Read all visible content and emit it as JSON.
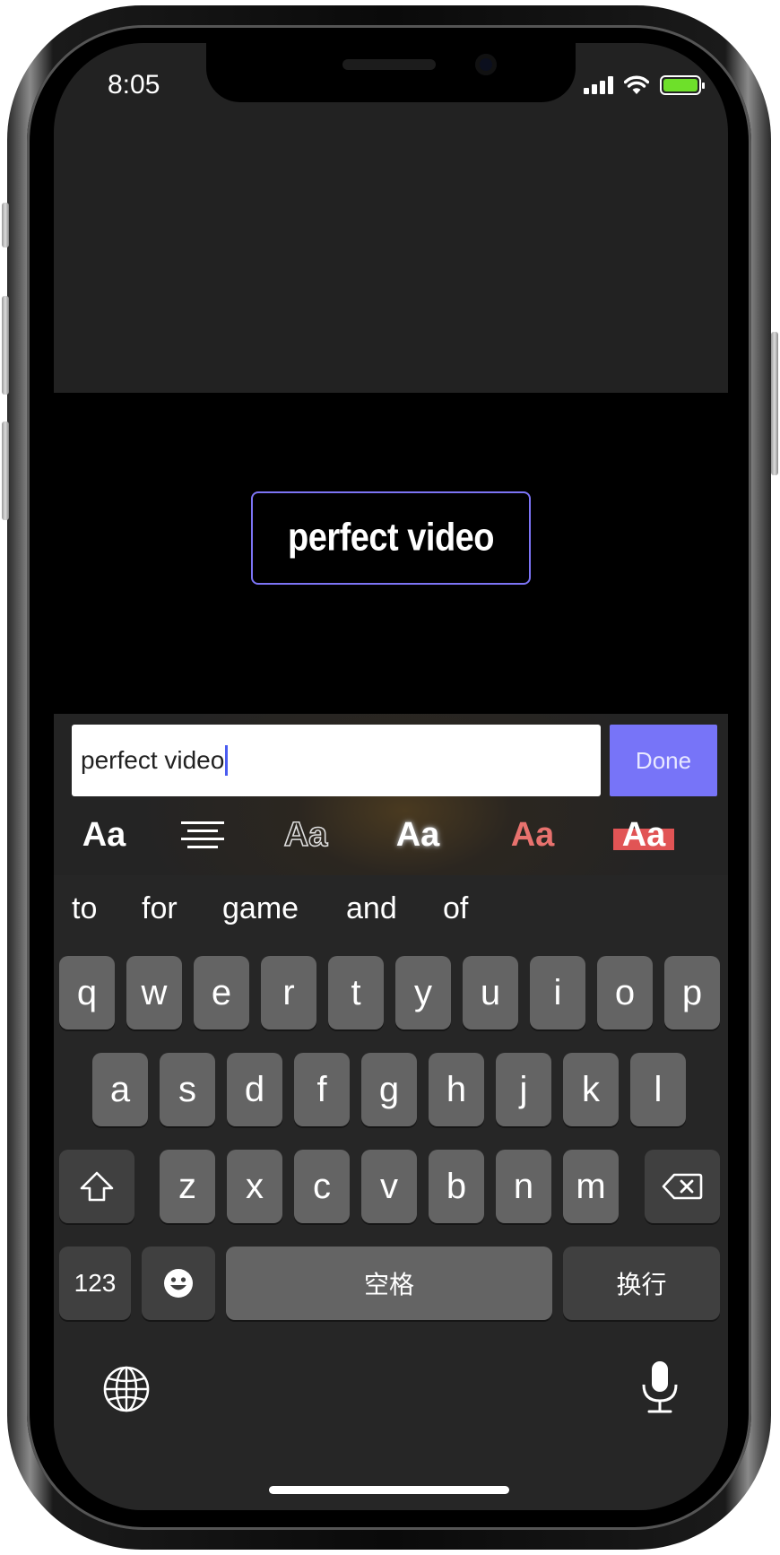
{
  "status_bar": {
    "time": "8:05",
    "icons": [
      "signal-icon",
      "wifi-icon",
      "battery-icon"
    ],
    "battery_color": "#6ee02a"
  },
  "preview": {
    "overlay_text": "perfect video",
    "selection_border_color": "#7c74f5"
  },
  "editor": {
    "input_value": "perfect video",
    "done_label": "Done",
    "done_color": "#7774f8",
    "style_options": [
      {
        "id": "plain",
        "label": "Aa"
      },
      {
        "id": "align",
        "icon": "align-center-icon"
      },
      {
        "id": "outline",
        "label": "Aa"
      },
      {
        "id": "glow",
        "label": "Aa"
      },
      {
        "id": "red",
        "label": "Aa",
        "color": "#e8726e"
      },
      {
        "id": "background",
        "label": "Aa",
        "color": "#e15455"
      }
    ]
  },
  "keyboard": {
    "suggestions": [
      "to",
      "for",
      "game",
      "and",
      "of"
    ],
    "row1": [
      "q",
      "w",
      "e",
      "r",
      "t",
      "y",
      "u",
      "i",
      "o",
      "p"
    ],
    "row2": [
      "a",
      "s",
      "d",
      "f",
      "g",
      "h",
      "j",
      "k",
      "l"
    ],
    "row3": [
      "z",
      "x",
      "c",
      "v",
      "b",
      "n",
      "m"
    ],
    "numbers_label": "123",
    "space_label": "空格",
    "return_label": "换行",
    "icons": [
      "shift-icon",
      "delete-icon",
      "emoji-icon",
      "globe-icon",
      "microphone-icon"
    ]
  }
}
